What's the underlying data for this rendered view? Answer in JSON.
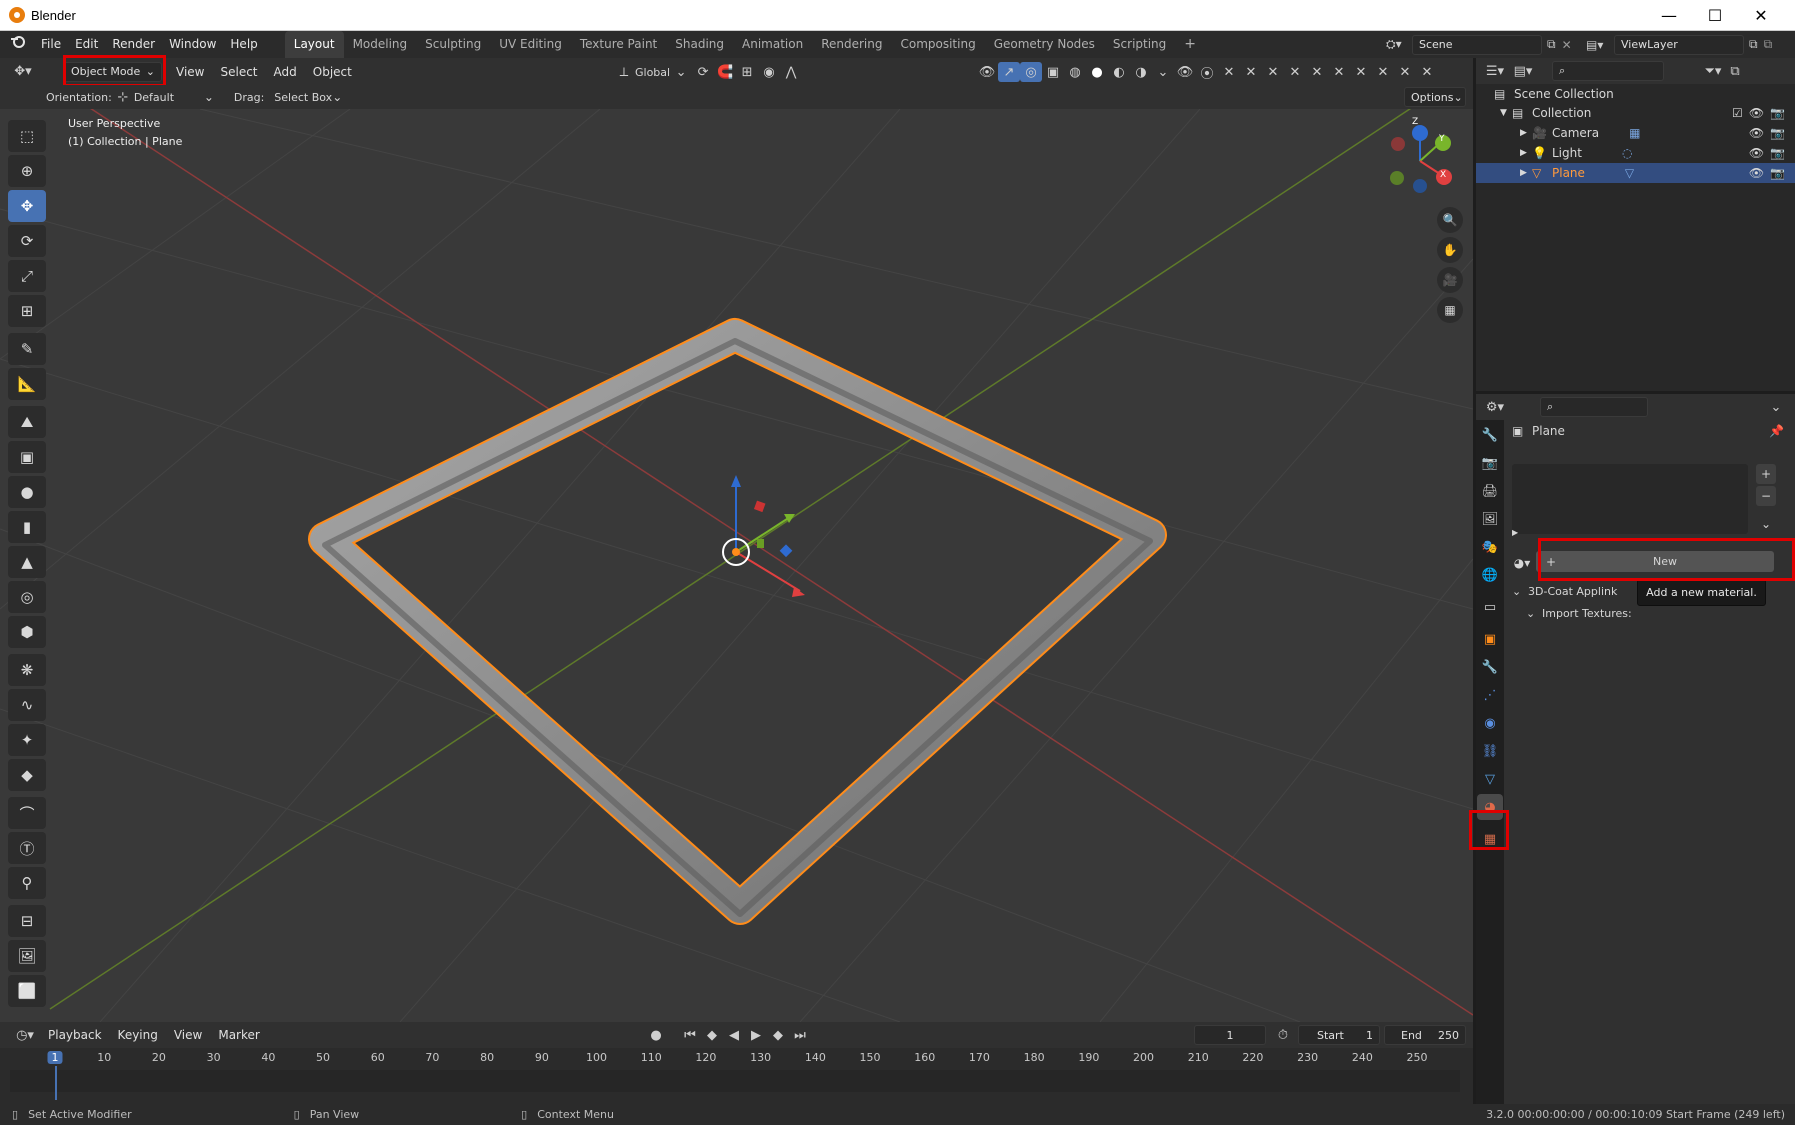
{
  "window": {
    "title": "Blender",
    "minimize": "—",
    "maximize": "☐",
    "close": "✕"
  },
  "menu": [
    "File",
    "Edit",
    "Render",
    "Window",
    "Help"
  ],
  "workspaces": [
    "Layout",
    "Modeling",
    "Sculpting",
    "UV Editing",
    "Texture Paint",
    "Shading",
    "Animation",
    "Rendering",
    "Compositing",
    "Geometry Nodes",
    "Scripting"
  ],
  "active_workspace": "Layout",
  "add_workspace": "+",
  "scene_name": "Scene",
  "view_layer": "ViewLayer",
  "header": {
    "mode": "Object Mode",
    "menus": [
      "View",
      "Select",
      "Add",
      "Object"
    ],
    "transform_orientation": "Global",
    "orientation_label": "Orientation:",
    "orientation_value": "Default",
    "drag_label": "Drag:",
    "drag_value": "Select Box",
    "options": "Options"
  },
  "viewport": {
    "perspective": "User Perspective",
    "collection_info": "(1) Collection | Plane",
    "gizmo_x": "X",
    "gizmo_y": "Y",
    "gizmo_z": "Z"
  },
  "outliner": {
    "root": "Scene Collection",
    "collection": "Collection",
    "items": [
      {
        "name": "Camera",
        "icon": "camera-icon"
      },
      {
        "name": "Light",
        "icon": "light-icon"
      },
      {
        "name": "Plane",
        "icon": "mesh-icon",
        "selected": true
      }
    ]
  },
  "properties": {
    "object_name": "Plane",
    "new_button": "New",
    "new_plus": "+",
    "tooltip": "Add a new material.",
    "panel_applink": "3D-Coat Applink",
    "panel_import": "Import Textures:"
  },
  "timeline": {
    "menus": [
      "Playback",
      "Keying",
      "View",
      "Marker"
    ],
    "current_frame": "1",
    "start_label": "Start",
    "start_value": "1",
    "end_label": "End",
    "end_value": "250",
    "ticks": [
      "1",
      "10",
      "20",
      "30",
      "40",
      "50",
      "60",
      "70",
      "80",
      "90",
      "100",
      "110",
      "120",
      "130",
      "140",
      "150",
      "160",
      "170",
      "180",
      "190",
      "200",
      "210",
      "220",
      "230",
      "240",
      "250"
    ]
  },
  "status": {
    "left": "Set Active Modifier",
    "middle": "Pan View",
    "right": "Context Menu",
    "info": "3.2.0  00:00:00:00 / 00:00:10:09  Start Frame (249 left)"
  },
  "colors": {
    "selection_outline": "#ff8c1a",
    "highlight_box": "#e00000",
    "active_tool": "#4772b3",
    "x_axis": "#d04646",
    "y_axis": "#7aa32d"
  }
}
